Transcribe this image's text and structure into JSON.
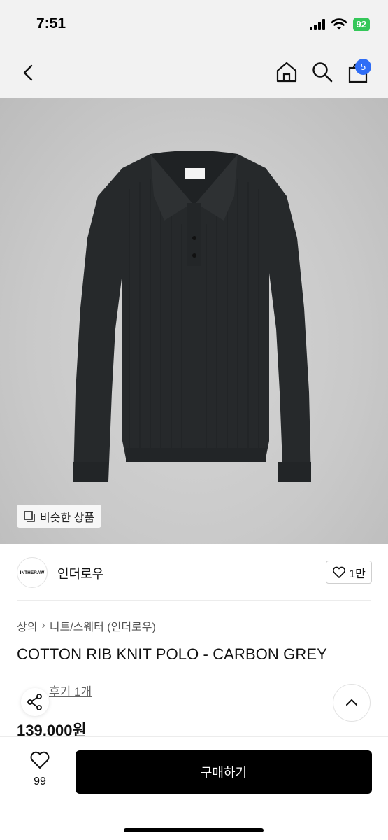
{
  "status_bar": {
    "time": "7:51",
    "battery": "92"
  },
  "nav": {
    "cart_count": "5"
  },
  "product": {
    "similar_label": "비슷한 상품",
    "brand_logo_text": "INTHERAW",
    "brand_name": "인더로우",
    "brand_likes": "1만",
    "breadcrumb": [
      "상의",
      "니트/스웨터 (인더로우)"
    ],
    "title": "COTTON RIB KNIT POLO - CARBON GREY",
    "review_label": "후기 1개",
    "price": "139,000원"
  },
  "bottom": {
    "wish_count": "99",
    "buy_label": "구매하기"
  },
  "colors": {
    "accent": "#2f6df6",
    "battery": "#34c759",
    "buy": "#000000"
  }
}
